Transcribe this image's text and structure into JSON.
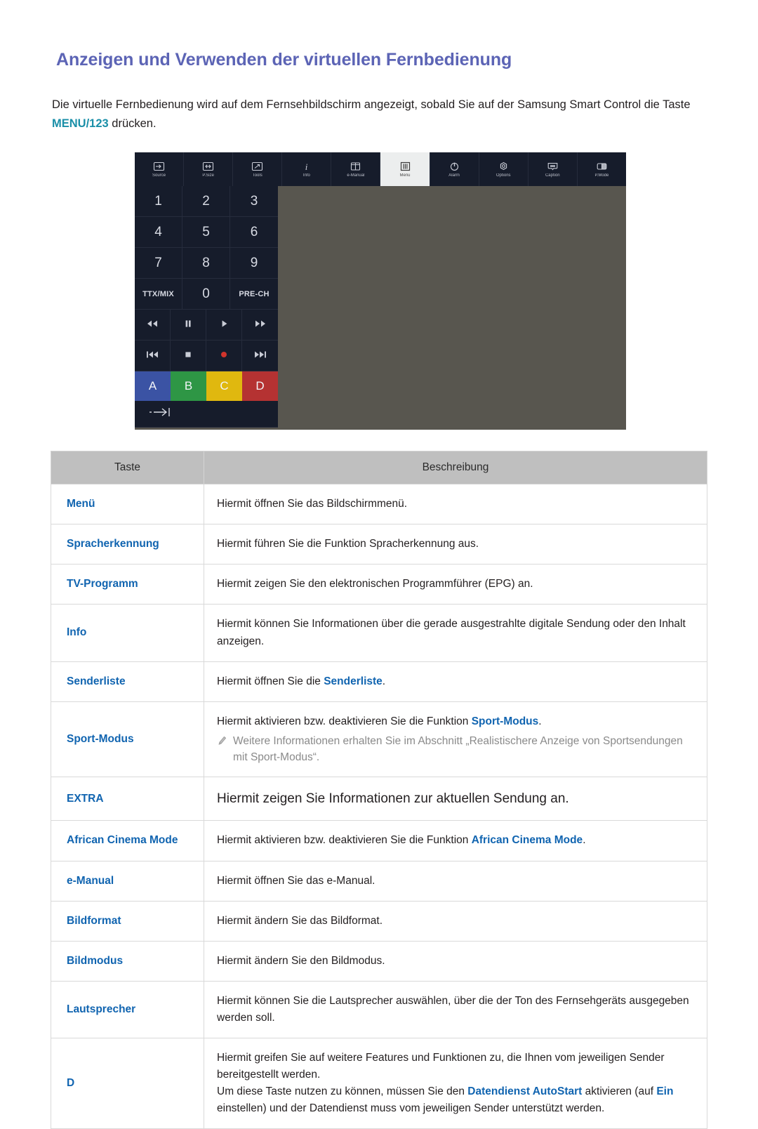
{
  "page": {
    "title": "Anzeigen und Verwenden der virtuellen Fernbedienung",
    "intro_part1": "Die virtuelle Fernbedienung wird auf dem Fernsehbildschirm angezeigt, sobald Sie auf der Samsung Smart Control die Taste ",
    "intro_accent": "MENU/123",
    "intro_part2": " drücken."
  },
  "colors": {
    "title": "#5c64b5",
    "accent_teal": "#1a8fa8",
    "term_blue": "#1064b0",
    "table_header_bg": "#bfbfbf",
    "remote_bg": "#161c2b",
    "figure_bg": "#58564f",
    "btn_a_blue": "#3b53a4",
    "btn_b_green": "#2e9645",
    "btn_c_yellow": "#e0b80f",
    "btn_d_red": "#b53232",
    "record_red": "#d0342c"
  },
  "remote": {
    "toolbar": [
      {
        "label": "Source",
        "icon": "source-icon",
        "active": false
      },
      {
        "label": "P.Size",
        "icon": "psize-icon",
        "active": false
      },
      {
        "label": "Tools",
        "icon": "tools-icon",
        "active": false
      },
      {
        "label": "Info",
        "icon": "info-icon",
        "active": false
      },
      {
        "label": "e-Manual",
        "icon": "emanual-icon",
        "active": false
      },
      {
        "label": "Menu",
        "icon": "menu-icon",
        "active": true
      },
      {
        "label": "Alarm",
        "icon": "alarm-icon",
        "active": false
      },
      {
        "label": "Options",
        "icon": "options-icon",
        "active": false
      },
      {
        "label": "Caption",
        "icon": "caption-icon",
        "active": false
      },
      {
        "label": "P.Mode",
        "icon": "pmode-icon",
        "active": false
      }
    ],
    "numpad": [
      "1",
      "2",
      "3",
      "4",
      "5",
      "6",
      "7",
      "8",
      "9",
      "TTX/MIX",
      "0",
      "PRE-CH"
    ],
    "media_row1": [
      "rewind-icon",
      "pause-icon",
      "play-icon",
      "fast-forward-icon"
    ],
    "media_row2": [
      "previous-icon",
      "stop-icon",
      "record-icon",
      "next-icon"
    ],
    "color_buttons": [
      {
        "label": "A",
        "color": "#3b53a4"
      },
      {
        "label": "B",
        "color": "#2e9645"
      },
      {
        "label": "C",
        "color": "#e0b80f"
      },
      {
        "label": "D",
        "color": "#b53232"
      }
    ],
    "tab_row_icon": "tab-arrow-icon"
  },
  "table": {
    "headers": {
      "col1": "Taste",
      "col2": "Beschreibung"
    },
    "rows": [
      {
        "term": "Menü",
        "desc": "Hiermit öffnen Sie das Bildschirmmenü."
      },
      {
        "term": "Spracherkennung",
        "desc": "Hiermit führen Sie die Funktion Spracherkennung aus."
      },
      {
        "term": "TV-Programm",
        "desc": "Hiermit zeigen Sie den elektronischen Programmführer (EPG) an."
      },
      {
        "term": "Info",
        "desc": "Hiermit können Sie Informationen über die gerade ausgestrahlte digitale Sendung oder den Inhalt anzeigen."
      },
      {
        "term": "Senderliste",
        "desc_pre": "Hiermit öffnen Sie die ",
        "desc_kw": "Senderliste",
        "desc_post": "."
      },
      {
        "term": "Sport-Modus",
        "desc_pre": "Hiermit aktivieren bzw. deaktivieren Sie die Funktion ",
        "desc_kw": "Sport-Modus",
        "desc_post": ".",
        "note": "Weitere Informationen erhalten Sie im Abschnitt „Realistischere Anzeige von Sportsendungen mit Sport-Modus“."
      },
      {
        "term": "EXTRA",
        "desc": "Hiermit zeigen Sie Informationen zur aktuellen Sendung an.",
        "large": true
      },
      {
        "term": "African Cinema Mode",
        "desc_pre": "Hiermit aktivieren bzw. deaktivieren Sie die Funktion ",
        "desc_kw": "African Cinema Mode",
        "desc_post": "."
      },
      {
        "term": "e-Manual",
        "desc": "Hiermit öffnen Sie das e-Manual."
      },
      {
        "term": "Bildformat",
        "desc": "Hiermit ändern Sie das Bildformat."
      },
      {
        "term": "Bildmodus",
        "desc": "Hiermit ändern Sie den Bildmodus."
      },
      {
        "term": "Lautsprecher",
        "desc": "Hiermit können Sie die Lautsprecher auswählen, über die der Ton des Fernsehgeräts ausgegeben werden soll."
      },
      {
        "term": "D",
        "desc_line1": "Hiermit greifen Sie auf weitere Features und Funktionen zu, die Ihnen vom jeweiligen Sender bereitgestellt werden.",
        "desc_line2_pre": "Um diese Taste nutzen zu können, müssen Sie den ",
        "desc_line2_kw1": "Datendienst AutoStart",
        "desc_line2_mid": " aktivieren (auf ",
        "desc_line2_kw2": "Ein",
        "desc_line2_post": " einstellen) und der Datendienst muss vom jeweiligen Sender unterstützt werden."
      }
    ]
  }
}
